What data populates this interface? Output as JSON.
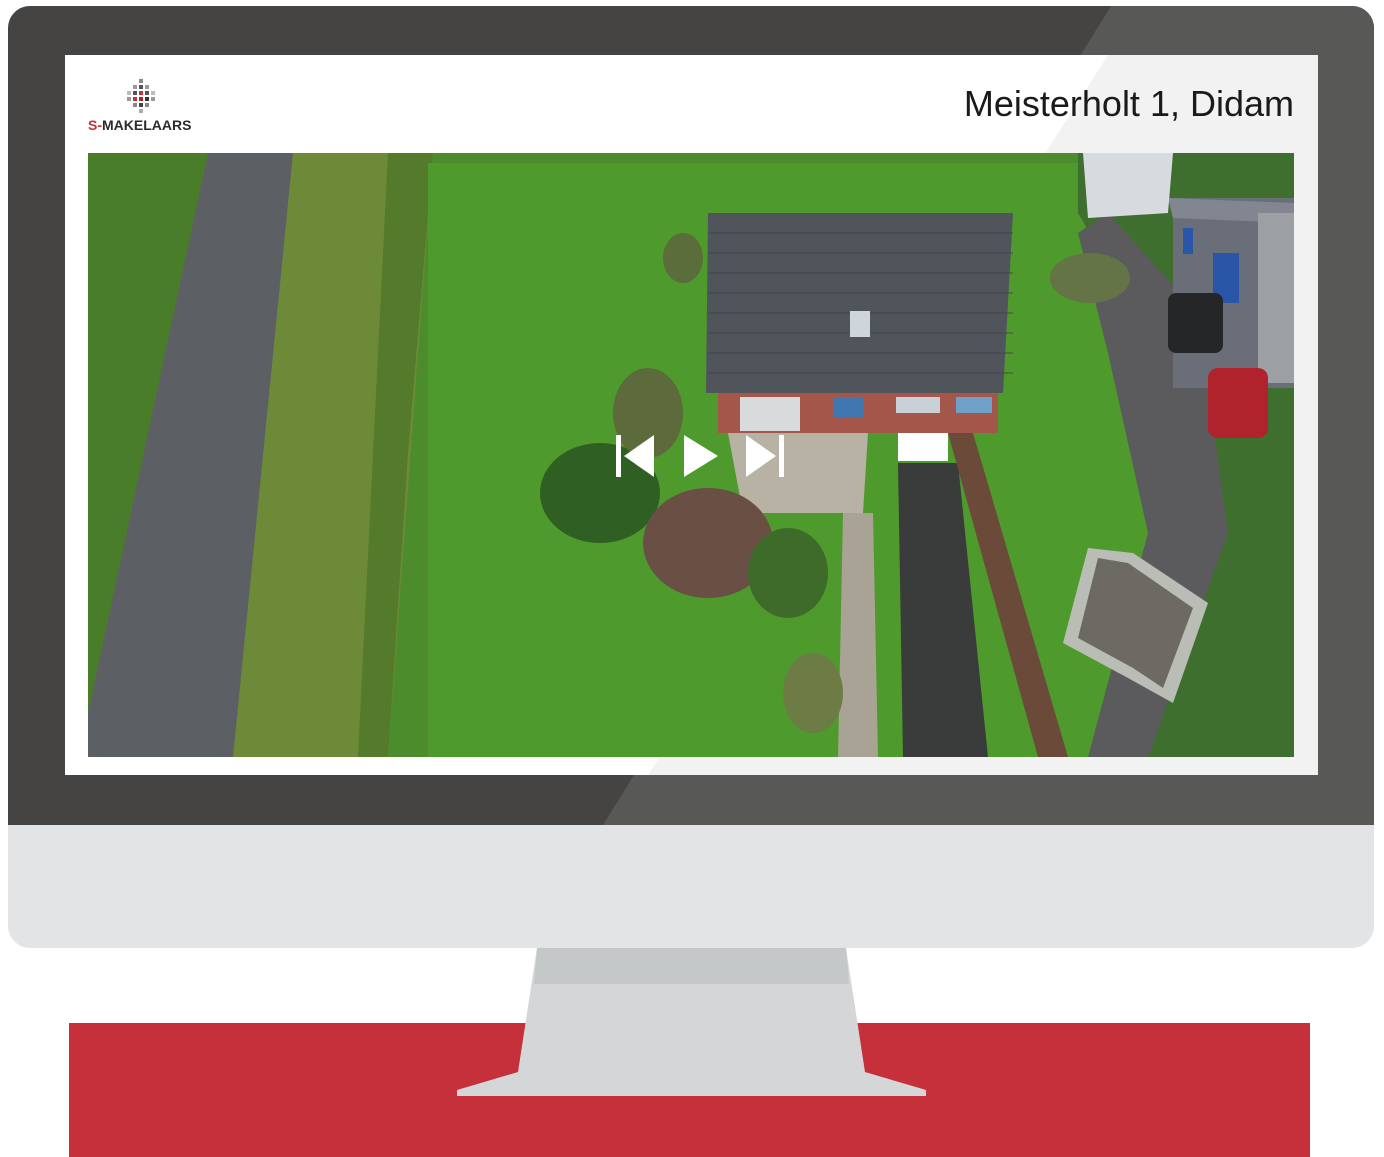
{
  "brand": {
    "logo_prefix": "S-",
    "logo_name": "MAKELAARS",
    "accent_color": "#c5303a"
  },
  "listing": {
    "address": "Meisterholt 1, Didam"
  },
  "player": {
    "controls": [
      {
        "name": "previous",
        "icon": "skip-back-icon"
      },
      {
        "name": "play",
        "icon": "play-icon"
      },
      {
        "name": "next",
        "icon": "skip-forward-icon"
      }
    ]
  },
  "colors": {
    "frame": "#454443",
    "chin": "#e3e4e6",
    "band": "#c5303a"
  }
}
